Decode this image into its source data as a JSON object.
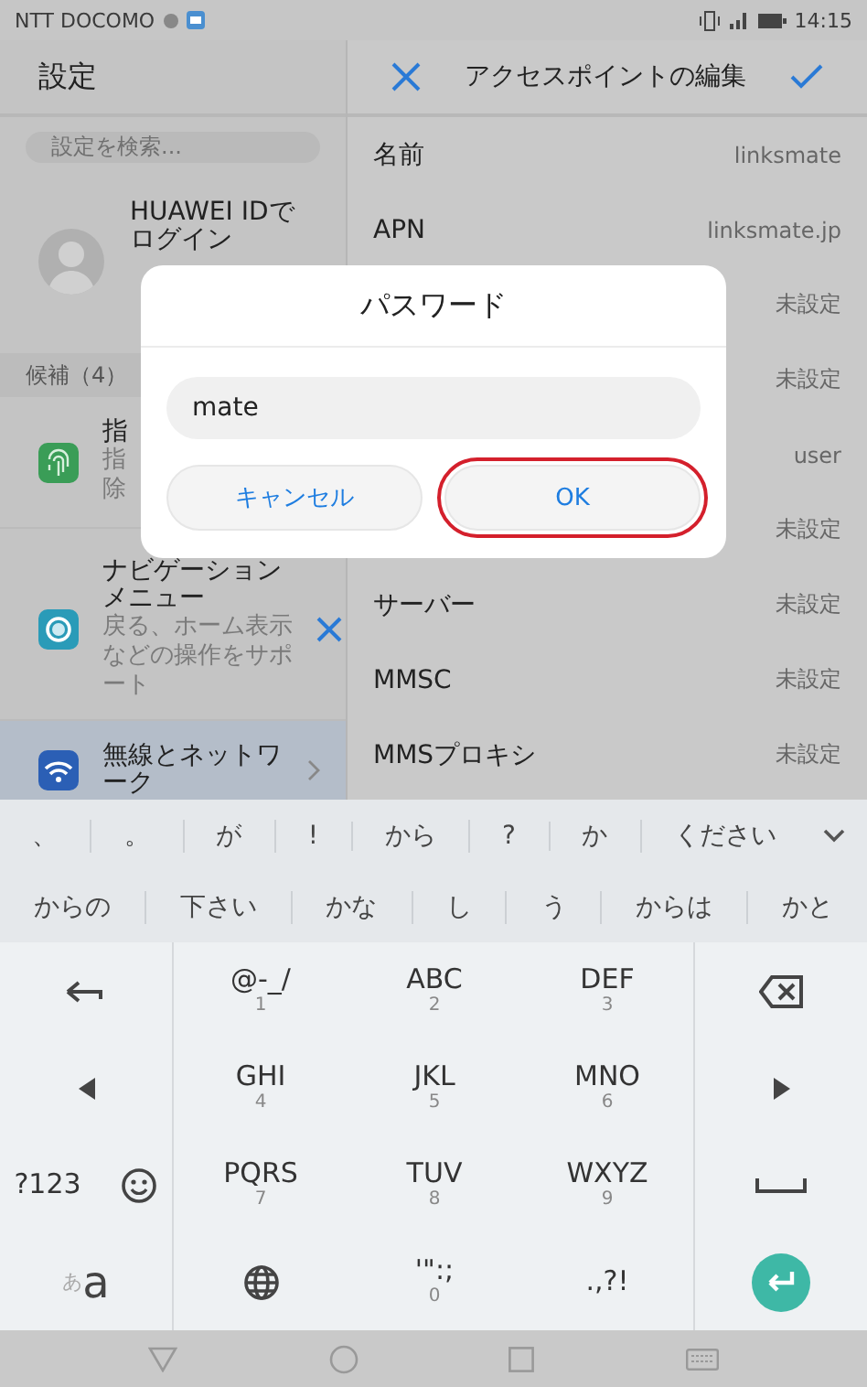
{
  "status_bar": {
    "carrier": "NTT DOCOMO",
    "time": "14:15"
  },
  "settings_pane": {
    "title": "設定",
    "search": {
      "placeholder": "設定を検索..."
    },
    "account": {
      "title_lines": [
        "HUAWEI IDで",
        "ログイン"
      ]
    },
    "section_header": "候補（4）",
    "items": [
      {
        "kind": "fingerprint",
        "title_lines": [
          "指"
        ],
        "sub_lines": [
          "指",
          "除"
        ],
        "dismissable": false,
        "selected": false
      },
      {
        "kind": "navigation",
        "title_lines": [
          "ナビゲーション",
          "メニュー"
        ],
        "sub_lines": [
          "戻る、ホーム表示",
          "などの操作をサポ",
          "ート"
        ],
        "dismissable": true,
        "selected": false
      },
      {
        "kind": "wireless",
        "title_lines": [
          "無線とネットワ",
          "ーク"
        ],
        "dismissable": false,
        "selected": true
      }
    ]
  },
  "apn_pane": {
    "title": "アクセスポイントの編集",
    "rows": [
      {
        "label": "名前",
        "value": "linksmate"
      },
      {
        "label": "APN",
        "value": "linksmate.jp"
      },
      {
        "value": "未設定"
      },
      {
        "value": "未設定"
      },
      {
        "value": "user"
      },
      {
        "value": "未設定"
      },
      {
        "label": "サーバー",
        "value": "未設定"
      },
      {
        "label": "MMSC",
        "value": "未設定"
      },
      {
        "label": "MMSプロキシ",
        "value": "未設定"
      }
    ]
  },
  "dialog": {
    "title": "パスワード",
    "value": "mate",
    "buttons": [
      {
        "label": "キャンセル",
        "highlighted": false
      },
      {
        "label": "OK",
        "highlighted": true
      }
    ]
  },
  "candidates": [
    [
      "、",
      "。",
      "が",
      "!",
      "から",
      "?",
      "か",
      "ください"
    ],
    [
      "からの",
      "下さい",
      "かな",
      "し",
      "う",
      "からは",
      "かと"
    ]
  ],
  "keypad": [
    [
      {
        "kind": "undo"
      },
      {
        "kind": "text",
        "main": "@-_/",
        "sub": "1"
      },
      {
        "kind": "text",
        "main": "ABC",
        "sub": "2"
      },
      {
        "kind": "text",
        "main": "DEF",
        "sub": "3"
      },
      {
        "kind": "backspace"
      }
    ],
    [
      {
        "kind": "left"
      },
      {
        "kind": "text",
        "main": "GHI",
        "sub": "4"
      },
      {
        "kind": "text",
        "main": "JKL",
        "sub": "5"
      },
      {
        "kind": "text",
        "main": "MNO",
        "sub": "6"
      },
      {
        "kind": "right"
      }
    ],
    [
      {
        "kind": "symbols",
        "label": "?123"
      },
      {
        "kind": "text",
        "main": "PQRS",
        "sub": "7"
      },
      {
        "kind": "text",
        "main": "TUV",
        "sub": "8"
      },
      {
        "kind": "text",
        "main": "WXYZ",
        "sub": "9"
      },
      {
        "kind": "space"
      }
    ],
    [
      {
        "kind": "kana",
        "small": "あ",
        "large": "a"
      },
      {
        "kind": "globe"
      },
      {
        "kind": "text",
        "main": "'\":;",
        "sub": "0"
      },
      {
        "kind": "text",
        "main": ".,?!"
      },
      {
        "kind": "enter"
      }
    ]
  ]
}
